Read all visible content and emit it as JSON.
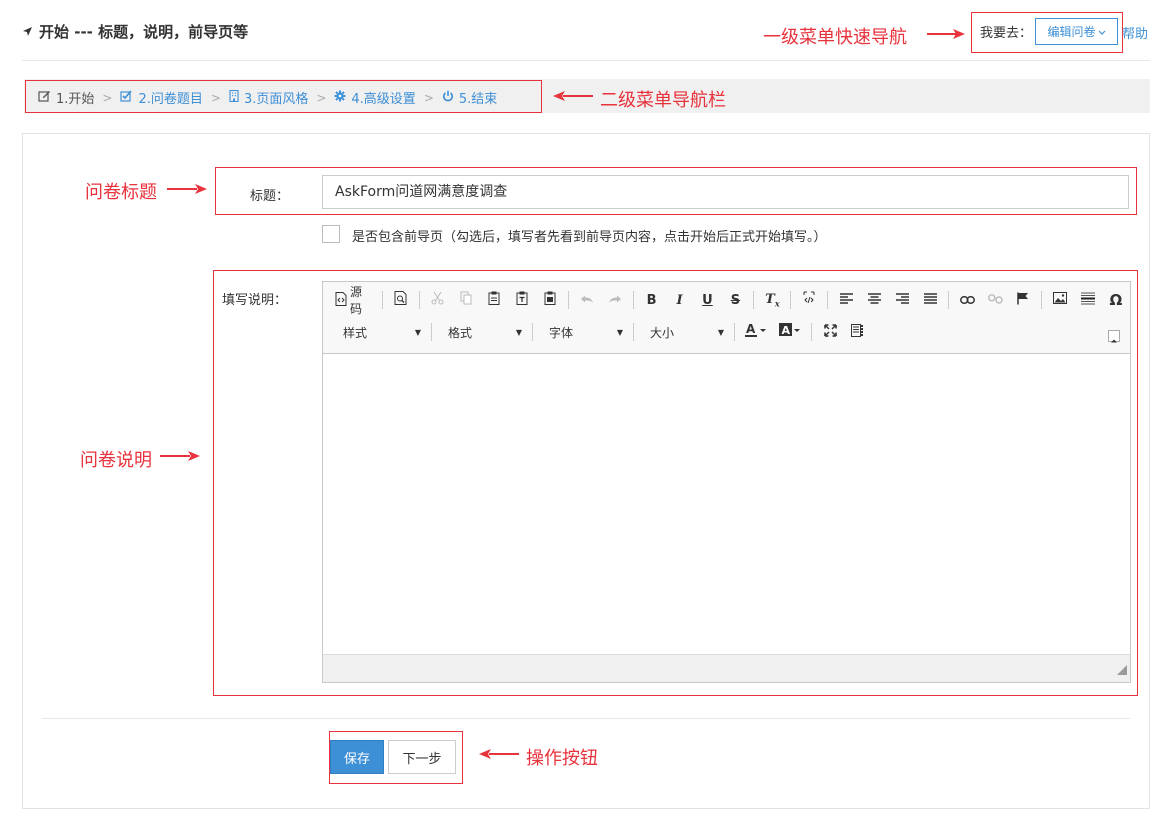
{
  "header": {
    "title": "开始 --- 标题，说明，前导页等",
    "goto_label": "我要去：",
    "goto_selected": "编辑问卷",
    "help": "帮助"
  },
  "steps": [
    {
      "label": "1.开始",
      "icon": "edit-icon"
    },
    {
      "label": "2.问卷题目",
      "icon": "checkbox-icon"
    },
    {
      "label": "3.页面风格",
      "icon": "building-icon"
    },
    {
      "label": "4.高级设置",
      "icon": "gear-icon"
    },
    {
      "label": "5.结束",
      "icon": "power-icon"
    }
  ],
  "form": {
    "title_label": "标题：",
    "title_value": "AskForm问道网满意度调查",
    "intro_checkbox_label": "是否包含前导页（勾选后，填写者先看到前导页内容，点击开始后正式开始填写。）",
    "desc_label": "填写说明："
  },
  "editor": {
    "source_label": "源码",
    "combos": [
      {
        "label": "样式"
      },
      {
        "label": "格式"
      },
      {
        "label": "字体"
      },
      {
        "label": "大小"
      }
    ]
  },
  "buttons": {
    "save": "保存",
    "next": "下一步"
  },
  "annotations": {
    "top_menu": "一级菜单快速导航",
    "step_nav": "二级菜单导航栏",
    "title": "问卷标题",
    "desc": "问卷说明",
    "actions": "操作按钮"
  },
  "colors": {
    "accent": "#3d8fd6",
    "annotation": "#e8323c"
  }
}
